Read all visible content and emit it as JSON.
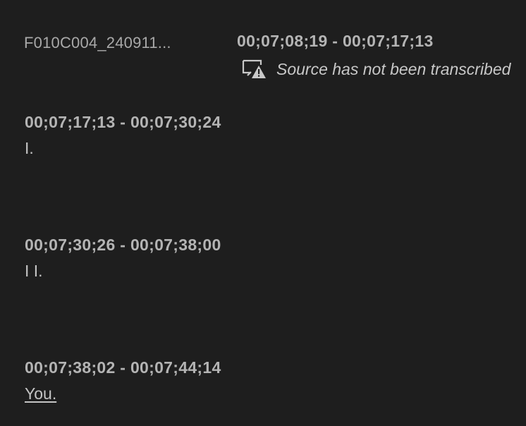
{
  "clip": {
    "name": "F010C004_240911..."
  },
  "untranscribed_block": {
    "timecode": "00;07;08;19 - 00;07;17;13",
    "notice_icon": "monitor-warning-icon",
    "notice_text": "Source has not been transcribed"
  },
  "segments": [
    {
      "timecode": "00;07;17;13 - 00;07;30;24",
      "text": "I."
    },
    {
      "timecode": "00;07;30;26 - 00;07;38;00",
      "text": "I I."
    },
    {
      "timecode": "00;07;38;02 - 00;07;44;14",
      "text": "You."
    }
  ],
  "colors": {
    "background": "#1e1e1e",
    "timecode": "#b4b4b4",
    "text": "#c4c4c4",
    "clip_name": "#a9a9a9"
  }
}
